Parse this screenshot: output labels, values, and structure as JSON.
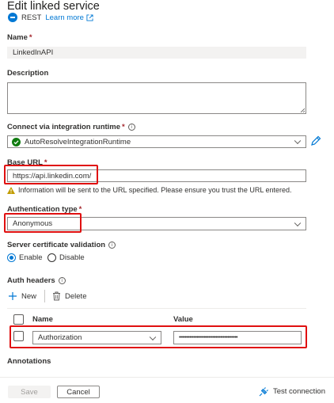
{
  "header": {
    "title": "Edit linked service",
    "type_label": "REST",
    "learn_more": "Learn more"
  },
  "fields": {
    "name": {
      "label": "Name",
      "value": "LinkedInAPI"
    },
    "description": {
      "label": "Description",
      "value": ""
    },
    "runtime": {
      "label": "Connect via integration runtime",
      "value": "AutoResolveIntegrationRuntime"
    },
    "base_url": {
      "label": "Base URL",
      "value": "https://api.linkedin.com/",
      "warning": "Information will be sent to the URL specified. Please ensure you trust the URL entered."
    },
    "auth_type": {
      "label": "Authentication type",
      "value": "Anonymous"
    },
    "server_cert": {
      "label": "Server certificate validation",
      "options": [
        "Enable",
        "Disable"
      ],
      "selected": "Enable"
    }
  },
  "auth_headers": {
    "label": "Auth headers",
    "new_label": "New",
    "delete_label": "Delete",
    "columns": [
      "Name",
      "Value"
    ],
    "rows": [
      {
        "name": "Authorization",
        "value": "••••••••••••••••••••••••••••••••••••••••"
      }
    ]
  },
  "annotations": {
    "label": "Annotations"
  },
  "footer": {
    "save": "Save",
    "cancel": "Cancel",
    "test_connection": "Test connection"
  },
  "colors": {
    "accent": "#0078d4",
    "highlight": "#e01010",
    "success": "#107c10",
    "warning": "#c19c00"
  },
  "icons": [
    "rest-icon",
    "external-link-icon",
    "info-icon",
    "check-circle-icon",
    "pencil-icon",
    "warning-icon",
    "plus-icon",
    "trash-icon",
    "chevron-down-icon",
    "plug-icon"
  ]
}
